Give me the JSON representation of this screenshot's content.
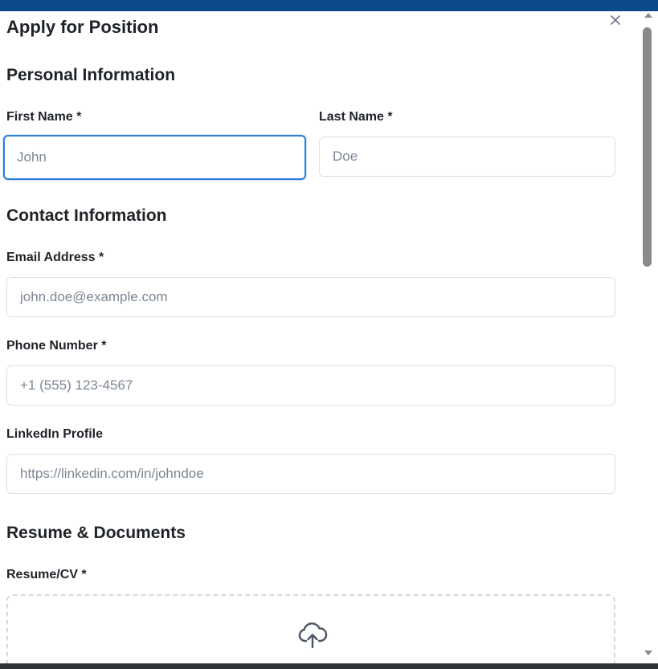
{
  "modal": {
    "title": "Apply for Position",
    "close_icon": "close-icon"
  },
  "personal": {
    "heading": "Personal Information",
    "first_name_label": "First Name *",
    "first_name_placeholder": "John",
    "last_name_label": "Last Name *",
    "last_name_placeholder": "Doe"
  },
  "contact": {
    "heading": "Contact Information",
    "email_label": "Email Address *",
    "email_placeholder": "john.doe@example.com",
    "phone_label": "Phone Number *",
    "phone_placeholder": "+1 (555) 123-4567",
    "linkedin_label": "LinkedIn Profile",
    "linkedin_placeholder": "https://linkedin.com/in/johndoe"
  },
  "documents": {
    "heading": "Resume & Documents",
    "resume_label": "Resume/CV *",
    "upload_icon": "cloud-upload-icon"
  },
  "colors": {
    "header_bar": "#0b4a8b",
    "focus_ring": "#2f7fd8",
    "input_border": "#dcdfe4",
    "placeholder": "#7c8693",
    "text": "#1f2328"
  }
}
